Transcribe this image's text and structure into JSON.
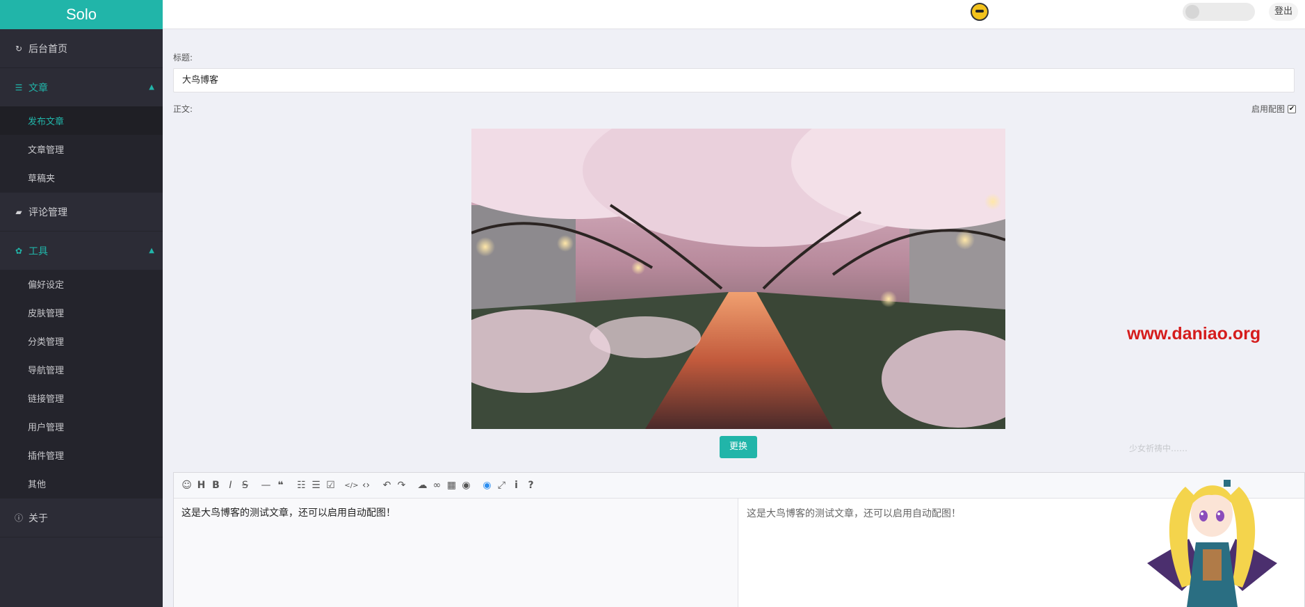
{
  "app": {
    "logo": "Solo"
  },
  "sidebar": {
    "home": {
      "label": "后台首页",
      "icon": "refresh-icon"
    },
    "articles": {
      "label": "文章",
      "icon": "list-icon",
      "items": [
        {
          "label": "发布文章"
        },
        {
          "label": "文章管理"
        },
        {
          "label": "草稿夹"
        }
      ]
    },
    "comments": {
      "label": "评论管理",
      "icon": "comments-icon"
    },
    "tools": {
      "label": "工具",
      "icon": "gear-icon",
      "items": [
        {
          "label": "偏好设定"
        },
        {
          "label": "皮肤管理"
        },
        {
          "label": "分类管理"
        },
        {
          "label": "导航管理"
        },
        {
          "label": "链接管理"
        },
        {
          "label": "用户管理"
        },
        {
          "label": "插件管理"
        },
        {
          "label": "其他"
        }
      ]
    },
    "about": {
      "label": "关于",
      "icon": "info-circle-icon"
    }
  },
  "header": {
    "logout_label": "登出"
  },
  "form": {
    "title_label": "标题:",
    "title_value": "大鸟博客",
    "body_label": "正文:",
    "thumbnail_toggle_label": "启用配图",
    "thumbnail_enabled": true,
    "swap_button_label": "更换"
  },
  "watermark": "www.daniao.org",
  "ghost_text": "少女祈祷中……",
  "editor": {
    "toolbar_icons": [
      "emoji-icon",
      "heading-icon",
      "bold-icon",
      "italic-icon",
      "strike-icon",
      "hr-icon",
      "quote-icon",
      "bullet-list-icon",
      "ordered-list-icon",
      "checklist-icon",
      "inline-code-icon",
      "code-block-icon",
      "undo-icon",
      "redo-icon",
      "upload-icon",
      "link-icon",
      "table-icon",
      "record-icon",
      "preview-icon",
      "fullscreen-icon",
      "info-icon",
      "help-icon"
    ],
    "content": "这是大鸟博客的测试文章，还可以启用自动配图！",
    "preview": "这是大鸟博客的测试文章，还可以启用自动配图！"
  },
  "colors": {
    "accent": "#21b5a9",
    "sidebar_bg": "#2c2c36",
    "watermark": "#d51c1c"
  }
}
